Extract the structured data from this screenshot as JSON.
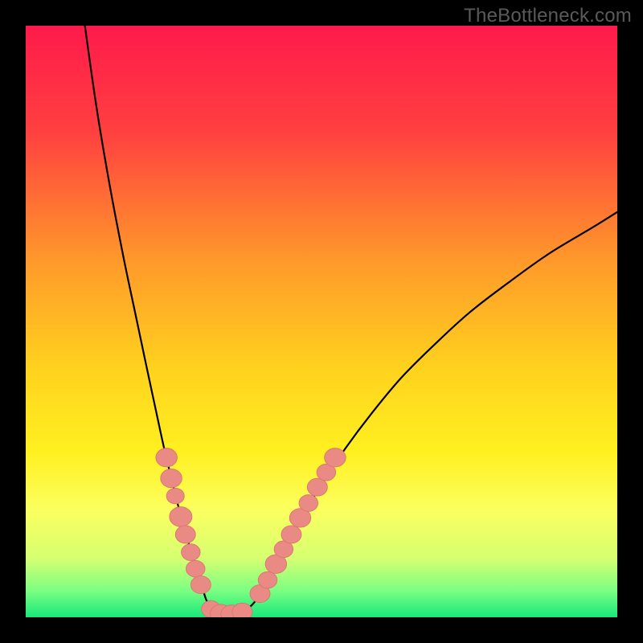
{
  "watermark": "TheBottleneck.com",
  "colors": {
    "black": "#000000",
    "curve": "#000000",
    "marker_fill": "#e98b84",
    "marker_stroke": "#d9756e"
  },
  "chart_data": {
    "type": "line",
    "title": "",
    "xlabel": "",
    "ylabel": "",
    "xlim": [
      0,
      100
    ],
    "ylim": [
      0,
      100
    ],
    "gradient_stops": [
      {
        "pos": 0.0,
        "color": "#ff1a4b"
      },
      {
        "pos": 0.18,
        "color": "#ff4040"
      },
      {
        "pos": 0.4,
        "color": "#ff9a2a"
      },
      {
        "pos": 0.58,
        "color": "#ffd21e"
      },
      {
        "pos": 0.72,
        "color": "#fff020"
      },
      {
        "pos": 0.82,
        "color": "#fbff60"
      },
      {
        "pos": 0.9,
        "color": "#d6ff70"
      },
      {
        "pos": 0.955,
        "color": "#7bff82"
      },
      {
        "pos": 1.0,
        "color": "#17e87a"
      }
    ],
    "series": [
      {
        "name": "left-branch",
        "x": [
          10.0,
          12.0,
          14.2,
          16.5,
          18.6,
          20.5,
          22.0,
          23.3,
          24.5,
          25.6,
          26.7,
          27.7,
          28.7,
          29.6,
          30.5
        ],
        "y": [
          100.0,
          86.0,
          73.0,
          61.0,
          51.0,
          42.0,
          35.0,
          29.0,
          24.0,
          19.5,
          15.5,
          12.0,
          9.0,
          6.0,
          3.0
        ]
      },
      {
        "name": "valley",
        "x": [
          30.5,
          31.5,
          32.6,
          33.8,
          35.0,
          36.3,
          37.6,
          39.0
        ],
        "y": [
          3.0,
          1.5,
          0.7,
          0.3,
          0.3,
          0.7,
          1.5,
          3.0
        ]
      },
      {
        "name": "right-branch",
        "x": [
          39.0,
          41.0,
          43.5,
          46.5,
          50.0,
          54.0,
          58.5,
          63.5,
          69.0,
          75.0,
          81.5,
          88.5,
          96.0,
          100.0
        ],
        "y": [
          3.0,
          6.5,
          11.0,
          16.5,
          22.5,
          28.5,
          34.5,
          40.5,
          46.0,
          51.5,
          56.5,
          61.5,
          66.0,
          68.5
        ]
      }
    ],
    "markers": [
      {
        "group": "left-cluster",
        "x": 23.8,
        "y": 27.0,
        "r": 1.8
      },
      {
        "group": "left-cluster",
        "x": 24.6,
        "y": 23.5,
        "r": 1.8
      },
      {
        "group": "left-cluster",
        "x": 25.3,
        "y": 20.5,
        "r": 1.5
      },
      {
        "group": "left-cluster",
        "x": 26.2,
        "y": 17.0,
        "r": 1.9
      },
      {
        "group": "left-cluster",
        "x": 27.0,
        "y": 14.0,
        "r": 1.7
      },
      {
        "group": "left-cluster",
        "x": 27.9,
        "y": 11.0,
        "r": 1.6
      },
      {
        "group": "left-cluster",
        "x": 28.7,
        "y": 8.2,
        "r": 1.6
      },
      {
        "group": "left-cluster",
        "x": 29.6,
        "y": 5.5,
        "r": 1.7
      },
      {
        "group": "bottom",
        "x": 31.3,
        "y": 1.4,
        "r": 1.6
      },
      {
        "group": "bottom",
        "x": 33.0,
        "y": 0.6,
        "r": 1.8
      },
      {
        "group": "bottom",
        "x": 34.8,
        "y": 0.5,
        "r": 1.8
      },
      {
        "group": "bottom",
        "x": 36.6,
        "y": 0.9,
        "r": 1.7
      },
      {
        "group": "right-cluster",
        "x": 39.6,
        "y": 4.0,
        "r": 1.7
      },
      {
        "group": "right-cluster",
        "x": 40.9,
        "y": 6.3,
        "r": 1.6
      },
      {
        "group": "right-cluster",
        "x": 42.3,
        "y": 9.0,
        "r": 1.8
      },
      {
        "group": "right-cluster",
        "x": 43.6,
        "y": 11.5,
        "r": 1.6
      },
      {
        "group": "right-cluster",
        "x": 44.9,
        "y": 14.0,
        "r": 1.7
      },
      {
        "group": "right-cluster",
        "x": 46.4,
        "y": 16.8,
        "r": 1.8
      },
      {
        "group": "right-cluster",
        "x": 47.8,
        "y": 19.3,
        "r": 1.6
      },
      {
        "group": "right-cluster",
        "x": 49.3,
        "y": 22.0,
        "r": 1.7
      },
      {
        "group": "right-cluster",
        "x": 50.8,
        "y": 24.5,
        "r": 1.6
      },
      {
        "group": "right-cluster",
        "x": 52.3,
        "y": 27.0,
        "r": 1.8
      }
    ]
  }
}
